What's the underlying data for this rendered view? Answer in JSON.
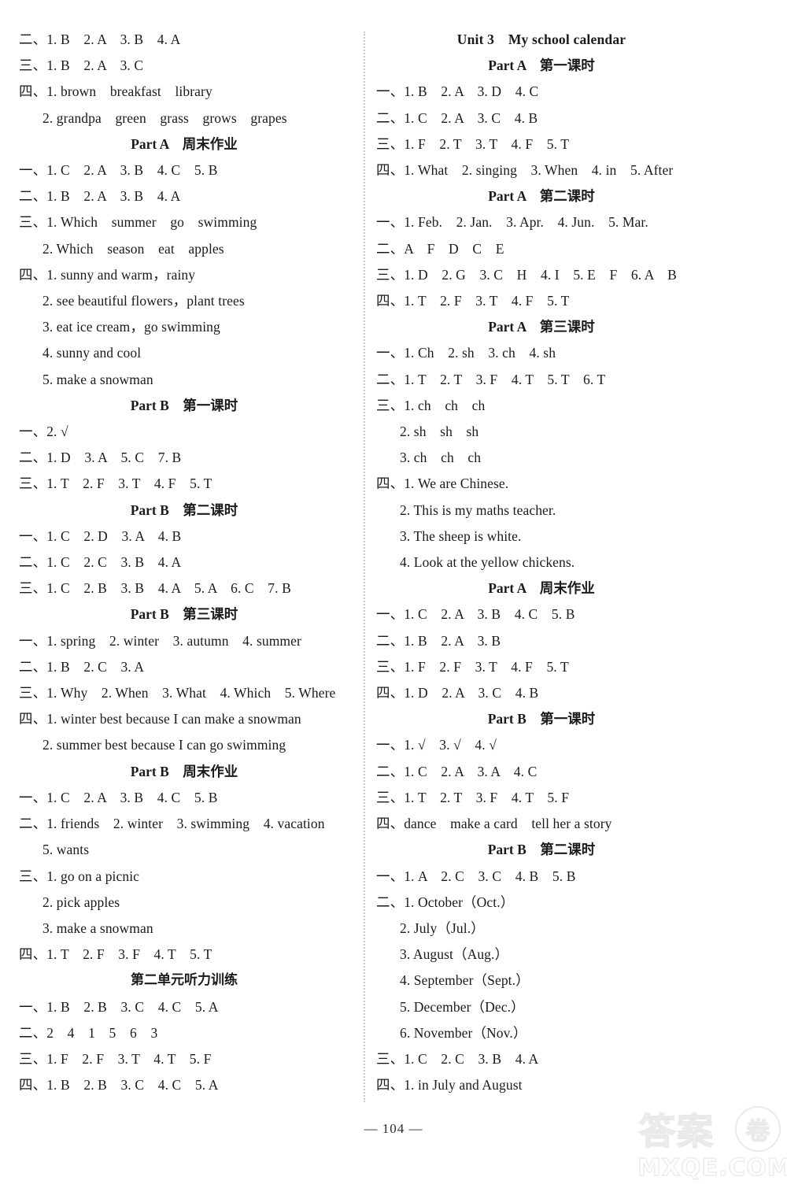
{
  "page": {
    "number_label": "— 104 —",
    "watermark": {
      "chinese": "答案",
      "circle_char": "卷",
      "url": "MXQE.COM"
    }
  },
  "left_column": {
    "lines": [
      {
        "kind": "answer",
        "text": "二、1. B　2. A　3. B　4. A"
      },
      {
        "kind": "answer",
        "text": "三、1. B　2. A　3. C"
      },
      {
        "kind": "answer",
        "text": "四、1. brown　breakfast　library"
      },
      {
        "kind": "answer",
        "indent": true,
        "text": "2. grandpa　green　grass　grows　grapes"
      },
      {
        "kind": "heading",
        "text": "Part A　周末作业"
      },
      {
        "kind": "answer",
        "text": "一、1. C　2. A　3. B　4. C　5. B"
      },
      {
        "kind": "answer",
        "text": "二、1. B　2. A　3. B　4. A"
      },
      {
        "kind": "answer",
        "text": "三、1. Which　summer　go　swimming"
      },
      {
        "kind": "answer",
        "indent": true,
        "text": "2. Which　season　eat　apples"
      },
      {
        "kind": "answer",
        "text": "四、1. sunny and warm，rainy"
      },
      {
        "kind": "answer",
        "indent": true,
        "text": "2. see beautiful flowers，plant trees"
      },
      {
        "kind": "answer",
        "indent": true,
        "text": "3. eat ice cream，go swimming"
      },
      {
        "kind": "answer",
        "indent": true,
        "text": "4. sunny and cool"
      },
      {
        "kind": "answer",
        "indent": true,
        "text": "5. make a snowman"
      },
      {
        "kind": "heading",
        "text": "Part B　第一课时"
      },
      {
        "kind": "answer",
        "text": "一、2. √"
      },
      {
        "kind": "answer",
        "text": "二、1. D　3. A　5. C　7. B"
      },
      {
        "kind": "answer",
        "text": "三、1. T　2. F　3. T　4. F　5. T"
      },
      {
        "kind": "heading",
        "text": "Part B　第二课时"
      },
      {
        "kind": "answer",
        "text": "一、1. C　2. D　3. A　4. B"
      },
      {
        "kind": "answer",
        "text": "二、1. C　2. C　3. B　4. A"
      },
      {
        "kind": "answer",
        "text": "三、1. C　2. B　3. B　4. A　5. A　6. C　7. B"
      },
      {
        "kind": "heading",
        "text": "Part B　第三课时"
      },
      {
        "kind": "answer",
        "text": "一、1. spring　2. winter　3. autumn　4. summer"
      },
      {
        "kind": "answer",
        "text": "二、1. B　2. C　3. A"
      },
      {
        "kind": "answer",
        "text": "三、1. Why　2. When　3. What　4. Which　5. Where"
      },
      {
        "kind": "answer",
        "text": "四、1. winter best because I can make a snowman"
      },
      {
        "kind": "answer",
        "indent": true,
        "text": "2. summer best because I can go swimming"
      },
      {
        "kind": "heading",
        "text": "Part B　周末作业"
      },
      {
        "kind": "answer",
        "text": "一、1. C　2. A　3. B　4. C　5. B"
      },
      {
        "kind": "answer",
        "text": "二、1. friends　2. winter　3. swimming　4. vacation"
      },
      {
        "kind": "answer",
        "indent": true,
        "text": "5. wants"
      },
      {
        "kind": "answer",
        "text": "三、1. go on a picnic"
      },
      {
        "kind": "answer",
        "indent": true,
        "text": "2. pick apples"
      },
      {
        "kind": "answer",
        "indent": true,
        "text": "3. make a snowman"
      },
      {
        "kind": "answer",
        "text": "四、1. T　2. F　3. F　4. T　5. T"
      },
      {
        "kind": "heading",
        "cn": true,
        "text": "第二单元听力训练"
      },
      {
        "kind": "answer",
        "text": "一、1. B　2. B　3. C　4. C　5. A"
      },
      {
        "kind": "answer",
        "text": "二、2　4　1　5　6　3"
      },
      {
        "kind": "answer",
        "text": "三、1. F　2. F　3. T　4. T　5. F"
      },
      {
        "kind": "answer",
        "text": "四、1. B　2. B　3. C　4. C　5. A"
      }
    ]
  },
  "right_column": {
    "lines": [
      {
        "kind": "heading",
        "unit": true,
        "text": "Unit 3　My school calendar"
      },
      {
        "kind": "heading",
        "text": "Part A　第一课时"
      },
      {
        "kind": "answer",
        "text": "一、1. B　2. A　3. D　4. C"
      },
      {
        "kind": "answer",
        "text": "二、1. C　2. A　3. C　4. B"
      },
      {
        "kind": "answer",
        "text": "三、1. F　2. T　3. T　4. F　5. T"
      },
      {
        "kind": "answer",
        "text": "四、1. What　2. singing　3. When　4. in　5. After"
      },
      {
        "kind": "heading",
        "text": "Part A　第二课时"
      },
      {
        "kind": "answer",
        "text": "一、1. Feb.　2. Jan.　3. Apr.　4. Jun.　5. Mar."
      },
      {
        "kind": "answer",
        "text": "二、A　F　D　C　E"
      },
      {
        "kind": "answer",
        "text": "三、1. D　2. G　3. C　H　4. I　5. E　F　6. A　B"
      },
      {
        "kind": "answer",
        "text": "四、1. T　2. F　3. T　4. F　5. T"
      },
      {
        "kind": "heading",
        "text": "Part A　第三课时"
      },
      {
        "kind": "answer",
        "text": "一、1. Ch　2. sh　3. ch　4. sh"
      },
      {
        "kind": "answer",
        "text": "二、1. T　2. T　3. F　4. T　5. T　6. T"
      },
      {
        "kind": "answer",
        "text": "三、1. ch　ch　ch"
      },
      {
        "kind": "answer",
        "indent": true,
        "text": "2. sh　sh　sh"
      },
      {
        "kind": "answer",
        "indent": true,
        "text": "3. ch　ch　ch"
      },
      {
        "kind": "answer",
        "text": "四、1. We are Chinese."
      },
      {
        "kind": "answer",
        "indent": true,
        "text": "2. This is my maths teacher."
      },
      {
        "kind": "answer",
        "indent": true,
        "text": "3. The sheep is white."
      },
      {
        "kind": "answer",
        "indent": true,
        "text": "4. Look at the yellow chickens."
      },
      {
        "kind": "heading",
        "text": "Part A　周末作业"
      },
      {
        "kind": "answer",
        "text": "一、1. C　2. A　3. B　4. C　5. B"
      },
      {
        "kind": "answer",
        "text": "二、1. B　2. A　3. B"
      },
      {
        "kind": "answer",
        "text": "三、1. F　2. F　3. T　4. F　5. T"
      },
      {
        "kind": "answer",
        "text": "四、1. D　2. A　3. C　4. B"
      },
      {
        "kind": "heading",
        "text": "Part B　第一课时"
      },
      {
        "kind": "answer",
        "text": "一、1. √　3. √　4. √"
      },
      {
        "kind": "answer",
        "text": "二、1. C　2. A　3. A　4. C"
      },
      {
        "kind": "answer",
        "text": "三、1. T　2. T　3. F　4. T　5. F"
      },
      {
        "kind": "answer",
        "text": "四、dance　make a card　tell her a story"
      },
      {
        "kind": "heading",
        "text": "Part B　第二课时"
      },
      {
        "kind": "answer",
        "text": "一、1. A　2. C　3. C　4. B　5. B"
      },
      {
        "kind": "answer",
        "text": "二、1. October（Oct.）"
      },
      {
        "kind": "answer",
        "indent": true,
        "text": "2. July（Jul.）"
      },
      {
        "kind": "answer",
        "indent": true,
        "text": "3. August（Aug.）"
      },
      {
        "kind": "answer",
        "indent": true,
        "text": "4. September（Sept.）"
      },
      {
        "kind": "answer",
        "indent": true,
        "text": "5. December（Dec.）"
      },
      {
        "kind": "answer",
        "indent": true,
        "text": "6. November（Nov.）"
      },
      {
        "kind": "answer",
        "text": "三、1. C　2. C　3. B　4. A"
      },
      {
        "kind": "answer",
        "text": "四、1. in July and August"
      }
    ]
  }
}
